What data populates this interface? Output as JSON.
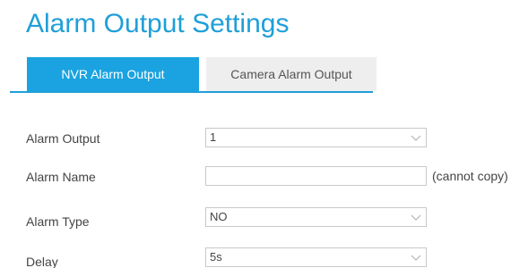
{
  "page": {
    "title": "Alarm Output Settings"
  },
  "tabs": [
    {
      "label": "NVR Alarm Output",
      "active": true
    },
    {
      "label": "Camera Alarm Output",
      "active": false
    }
  ],
  "form": {
    "alarm_output": {
      "label": "Alarm Output",
      "value": "1"
    },
    "alarm_name": {
      "label": "Alarm Name",
      "value": "",
      "note": "(cannot copy)"
    },
    "alarm_type": {
      "label": "Alarm Type",
      "value": "NO"
    },
    "delay": {
      "label": "Delay",
      "value": "5s"
    }
  },
  "icons": {
    "dropdown": "chevron-down-icon"
  },
  "colors": {
    "accent": "#1f9fd8",
    "tab_active_bg": "#1aa3e0",
    "tab_inactive_bg": "#eeeeee",
    "text": "#444444",
    "border": "#c8c8c8"
  }
}
